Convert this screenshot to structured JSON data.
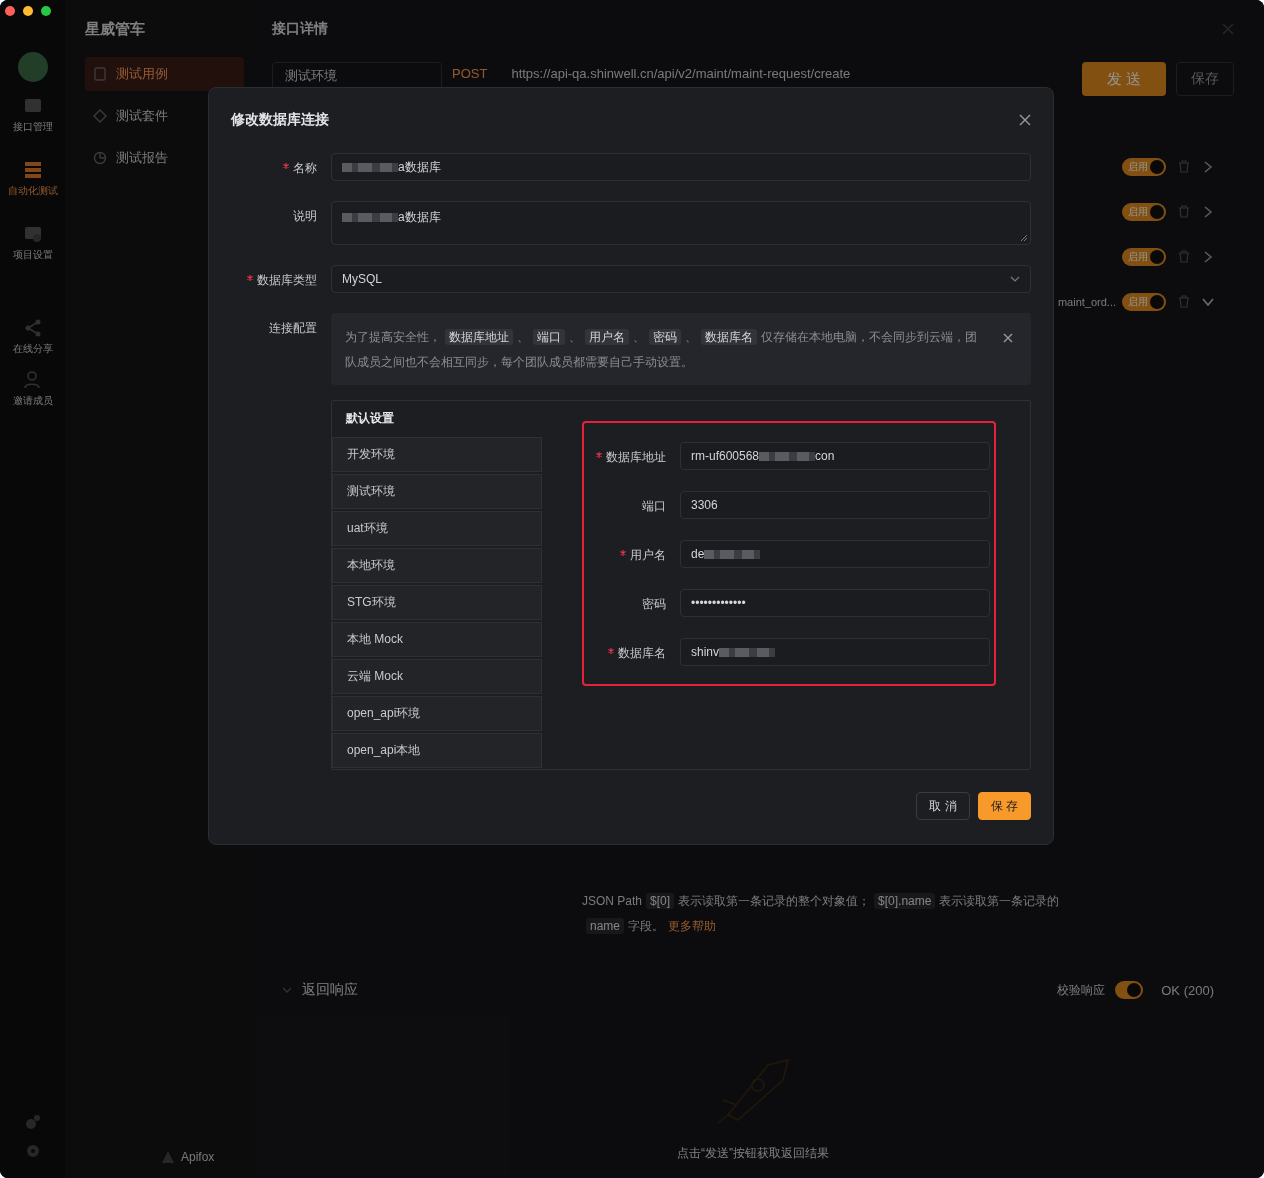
{
  "app": {
    "project": "星威管车",
    "rail": [
      {
        "label": "接口管理",
        "selected": false
      },
      {
        "label": "自动化测试",
        "selected": true
      },
      {
        "label": "项目设置",
        "selected": false
      },
      {
        "label": "在线分享",
        "selected": false
      },
      {
        "label": "邀请成员",
        "selected": false
      }
    ],
    "sidebar": [
      {
        "label": "测试用例",
        "selected": true
      },
      {
        "label": "测试套件",
        "selected": false
      },
      {
        "label": "测试报告",
        "selected": false
      }
    ],
    "brand": "Apifox"
  },
  "detail": {
    "title": "接口详情",
    "environment": "测试环境",
    "method": "POST",
    "url": "https://api-qa.shinwell.cn/api/v2/maint/maint-request/create",
    "send": "发 送",
    "save": "保存",
    "steps": [
      {
        "toggle": "启用",
        "on": true,
        "expanded": false
      },
      {
        "toggle": "启用",
        "on": true,
        "expanded": false
      },
      {
        "toggle": "启用",
        "on": true,
        "expanded": false
      },
      {
        "note": "maint_ord...",
        "toggle": "启用",
        "on": true,
        "expanded": true
      }
    ],
    "hint": [
      {
        "kind": "plain",
        "text": "JSON Path"
      },
      {
        "kind": "code",
        "text": "$[0]"
      },
      {
        "kind": "plain",
        "text": "表示读取第一条记录的整个对象值；"
      },
      {
        "kind": "code",
        "text": "$[0].name"
      },
      {
        "kind": "plain",
        "text": "表示读取第一条记录的"
      },
      {
        "kind": "code",
        "text": "name"
      },
      {
        "kind": "plain",
        "text": "字段。"
      },
      {
        "kind": "link",
        "text": "更多帮助"
      }
    ],
    "response": {
      "title": "返回响应",
      "check": "校验响应",
      "check_on": true,
      "status": "OK (200)",
      "empty": "点击“发送”按钮获取返回结果"
    }
  },
  "dialog": {
    "title": "修改数据库连接",
    "fields": [
      {
        "kind": "input",
        "label": "名称",
        "required": true,
        "value": [
          {
            "kind": "redacted"
          },
          {
            "kind": "text",
            "text": "a数据库"
          }
        ]
      },
      {
        "kind": "textarea",
        "label": "说明",
        "required": false,
        "value": [
          {
            "kind": "redacted"
          },
          {
            "kind": "text",
            "text": "a数据库"
          }
        ]
      },
      {
        "kind": "select",
        "label": "数据库类型",
        "required": true,
        "value": [
          {
            "kind": "text",
            "text": "MySQL"
          }
        ]
      }
    ],
    "config_label": "连接配置",
    "notice": [
      {
        "kind": "plain",
        "text": "为了提高安全性，"
      },
      {
        "kind": "code",
        "text": "数据库地址"
      },
      {
        "kind": "plain",
        "text": "、"
      },
      {
        "kind": "code",
        "text": "端口"
      },
      {
        "kind": "plain",
        "text": "、"
      },
      {
        "kind": "code",
        "text": "用户名"
      },
      {
        "kind": "plain",
        "text": "、"
      },
      {
        "kind": "code",
        "text": "密码"
      },
      {
        "kind": "plain",
        "text": "、"
      },
      {
        "kind": "code",
        "text": "数据库名"
      },
      {
        "kind": "plain",
        "text": "仅存储在本地电脑，不会同步到云端，团队成员之间也不会相互同步，每个团队成员都需要自己手动设置。"
      }
    ],
    "environments": [
      {
        "label": "默认设置",
        "selected": true
      },
      {
        "label": "开发环境",
        "selected": false
      },
      {
        "label": "测试环境",
        "selected": false
      },
      {
        "label": "uat环境",
        "selected": false
      },
      {
        "label": "本地环境",
        "selected": false
      },
      {
        "label": "STG环境",
        "selected": false
      },
      {
        "label": "本地 Mock",
        "selected": false
      },
      {
        "label": "云端 Mock",
        "selected": false
      },
      {
        "label": "open_api环境",
        "selected": false
      },
      {
        "label": "open_api本地",
        "selected": false
      }
    ],
    "connection": {
      "highlighted": true,
      "fields": [
        {
          "label": "数据库地址",
          "required": true,
          "value": [
            {
              "kind": "text",
              "text": "rm-uf600568"
            },
            {
              "kind": "redacted"
            },
            {
              "kind": "text",
              "text": "con"
            }
          ]
        },
        {
          "label": "端口",
          "required": false,
          "value": [
            {
              "kind": "text",
              "text": "3306"
            }
          ]
        },
        {
          "label": "用户名",
          "required": true,
          "value": [
            {
              "kind": "text",
              "text": "de"
            },
            {
              "kind": "redacted"
            }
          ]
        },
        {
          "label": "密码",
          "required": false,
          "value": [
            {
              "kind": "text",
              "text": "•••••••••••••"
            }
          ]
        },
        {
          "label": "数据库名",
          "required": true,
          "value": [
            {
              "kind": "text",
              "text": "shinv"
            },
            {
              "kind": "redacted"
            }
          ]
        }
      ]
    },
    "buttons": [
      {
        "label": "取 消",
        "primary": false
      },
      {
        "label": "保 存",
        "primary": true
      }
    ]
  }
}
